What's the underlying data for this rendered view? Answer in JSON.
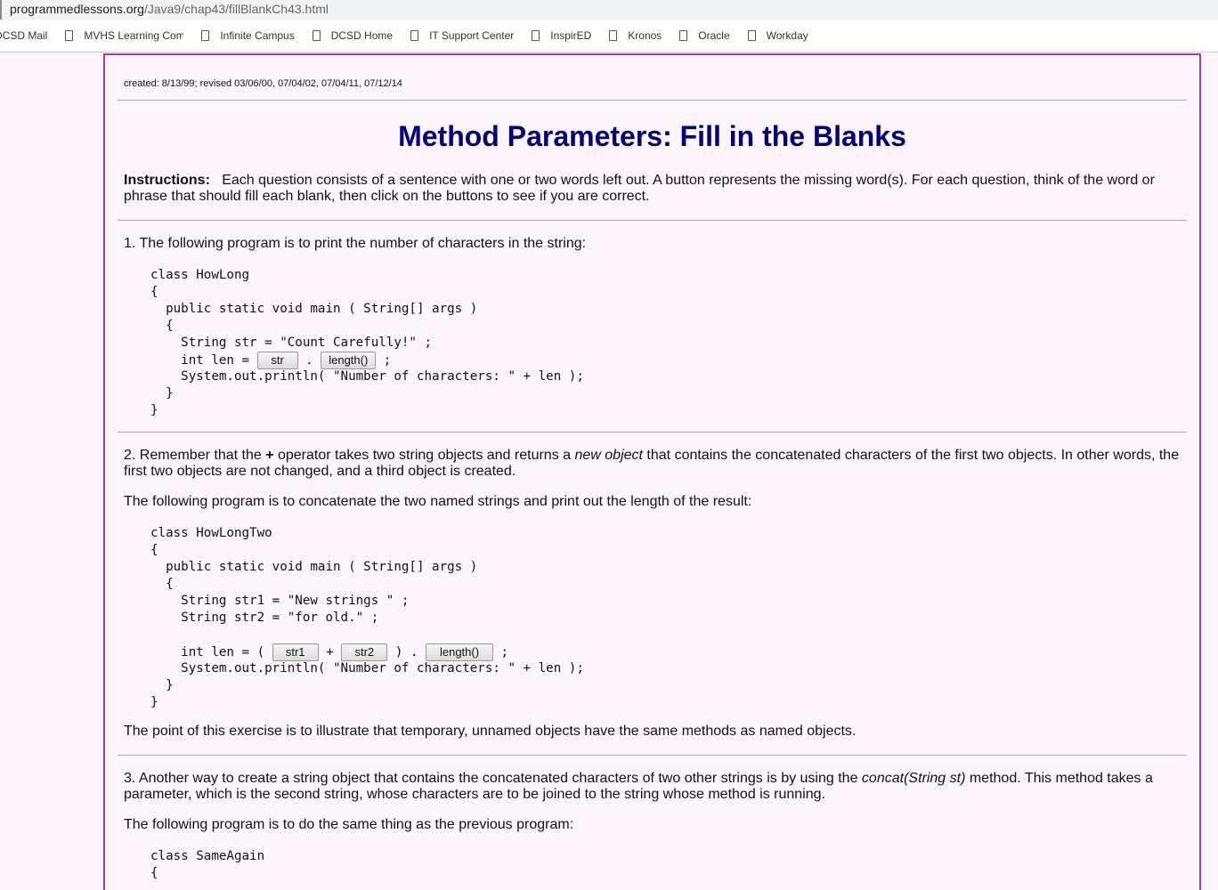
{
  "browser": {
    "url_host": "programmedlessons.org",
    "url_path": "/Java9/chap43/fillBlankCh43.html",
    "bookmarks": [
      "DCSD Mail",
      "MVHS Learning Com",
      "Infinite Campus",
      "DCSD Home",
      "IT Support Center",
      "InspirED",
      "Kronos",
      "Oracle",
      "Workday"
    ]
  },
  "created": "created: 8/13/99; revised 03/06/00, 07/04/02, 07/04/11, 07/12/14",
  "title": "Method Parameters: Fill in the Blanks",
  "instructions": {
    "label": "Instructions:",
    "text": "Each question consists of a sentence with one or two words left out. A button represents the missing word(s). For each question, think of the word or phrase that should fill each blank, then click on the buttons to see if you are correct."
  },
  "q1": {
    "text": "1.  The following program is to print the number of characters in the string:",
    "code": [
      [
        "class HowLong"
      ],
      [
        "{"
      ],
      [
        "  public static void main ( String[] args )"
      ],
      [
        "  {"
      ],
      [
        "    String str = \"Count Carefully!\" ;"
      ],
      [
        "    int len = ",
        {
          "b": "str",
          "w": 46
        },
        " . ",
        {
          "b": "length()",
          "w": 62
        },
        " ;"
      ],
      [
        "    System.out.println( \"Number of characters: \" + len );"
      ],
      [
        "  }"
      ],
      [
        "}"
      ]
    ]
  },
  "q2": {
    "t1": "2.  Remember that the ",
    "plus": "+",
    "t2": " operator takes two string objects and returns a ",
    "em": "new object",
    "t3": " that contains the concatenated characters of the first two objects. In other words, the first two objects are not changed, and a third object is created.",
    "p2": "The following program is to concatenate the two named strings and print out the length of the result:",
    "code": [
      [
        "class HowLongTwo"
      ],
      [
        "{"
      ],
      [
        "  public static void main ( String[] args )"
      ],
      [
        "  {"
      ],
      [
        "    String str1 = \"New strings \" ;"
      ],
      [
        "    String str2 = \"for old.\" ;"
      ],
      [
        ""
      ],
      [
        "    int len = ( ",
        {
          "b": "str1",
          "w": 52
        },
        " + ",
        {
          "b": "str2",
          "w": 52
        },
        " ) . ",
        {
          "b": "length()",
          "w": 76
        },
        " ;"
      ],
      [
        "    System.out.println( \"Number of characters: \" + len );"
      ],
      [
        "  }"
      ],
      [
        "}"
      ]
    ],
    "p3": "The point of this exercise is to illustrate that temporary, unnamed objects have the same methods as named objects."
  },
  "q3": {
    "t1": "3.  Another way to create a string object that contains the concatenated characters of two other strings is by using the ",
    "em": "concat(String st)",
    "t2": " method. This method takes a parameter, which is the second string, whose characters are to be joined to the string whose method is running.",
    "p2": "The following program is to do the same thing as the previous program:",
    "code": [
      [
        "class SameAgain"
      ],
      [
        "{"
      ]
    ]
  }
}
